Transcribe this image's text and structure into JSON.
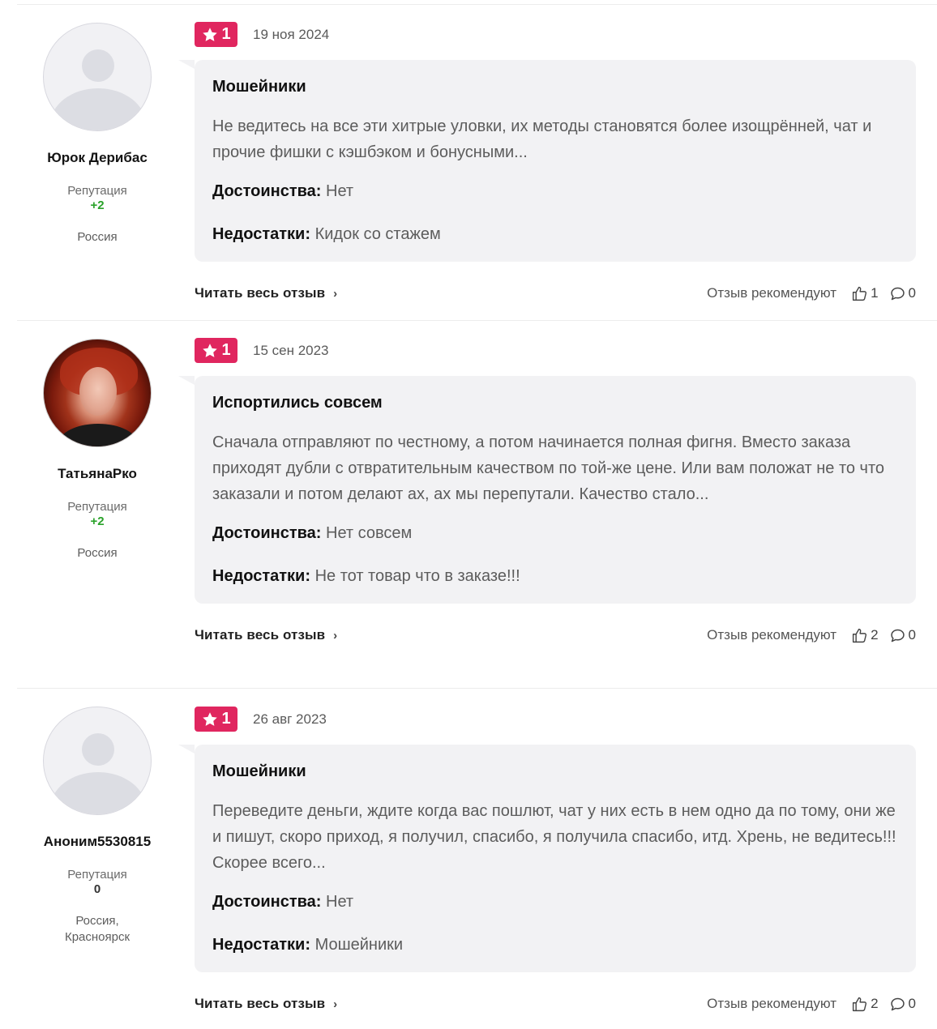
{
  "reviews": [
    {
      "author": "Юрок Дерибас",
      "avatar_icon": "default-avatar-icon",
      "reputation_label": "Репутация",
      "reputation": "+2",
      "location": "Россия",
      "rating": "1",
      "date": "19 ноя 2024",
      "title": "Мошейники",
      "text": "Не ведитесь на все эти хитрые уловки, их методы становятся более изощрённей, чат и прочие фишки с кэшбэком и бонусными...",
      "pros_label": "Достоинства:",
      "pros": "Нет",
      "cons_label": "Недостатки:",
      "cons": "Кидок со стажем",
      "read_more": "Читать весь отзыв",
      "recommend_label": "Отзыв рекомендуют",
      "likes": "1",
      "comments": "0"
    },
    {
      "author": "ТатьянаРко",
      "avatar_icon": "user-photo",
      "reputation_label": "Репутация",
      "reputation": "+2",
      "location": "Россия",
      "rating": "1",
      "date": "15 сен 2023",
      "title": "Испортились совсем",
      "text": "Сначала отправляют по честному, а потом начинается полная фигня. Вместо заказа приходят дубли с отвратительным качеством по той-же цене. Или вам положат не то что заказали и потом делают ах, ах мы перепутали. Качество стало...",
      "pros_label": "Достоинства:",
      "pros": "Нет совсем",
      "cons_label": "Недостатки:",
      "cons": "Не тот товар что в заказе!!!",
      "read_more": "Читать весь отзыв",
      "recommend_label": "Отзыв рекомендуют",
      "likes": "2",
      "comments": "0"
    },
    {
      "author": "Аноним5530815",
      "avatar_icon": "default-avatar-icon",
      "reputation_label": "Репутация",
      "reputation": "0",
      "location": "Россия,\nКрасноярск",
      "rating": "1",
      "date": "26 авг 2023",
      "title": "Мошейники",
      "text": "Переведите деньги, ждите когда вас пошлют, чат у них есть в нем одно да по тому, они же и пишут, скоро приход, я получил, спасибо, я получила спасибо, итд. Хрень, не ведитесь!!! Скорее всего...",
      "pros_label": "Достоинства:",
      "pros": "Нет",
      "cons_label": "Недостатки:",
      "cons": "Мошейники",
      "read_more": "Читать весь отзыв",
      "recommend_label": "Отзыв рекомендуют",
      "likes": "2",
      "comments": "0"
    }
  ],
  "colors": {
    "rating_badge": "#e0265f",
    "card_bg": "#f2f2f4",
    "reputation_positive": "#2aa22a"
  }
}
